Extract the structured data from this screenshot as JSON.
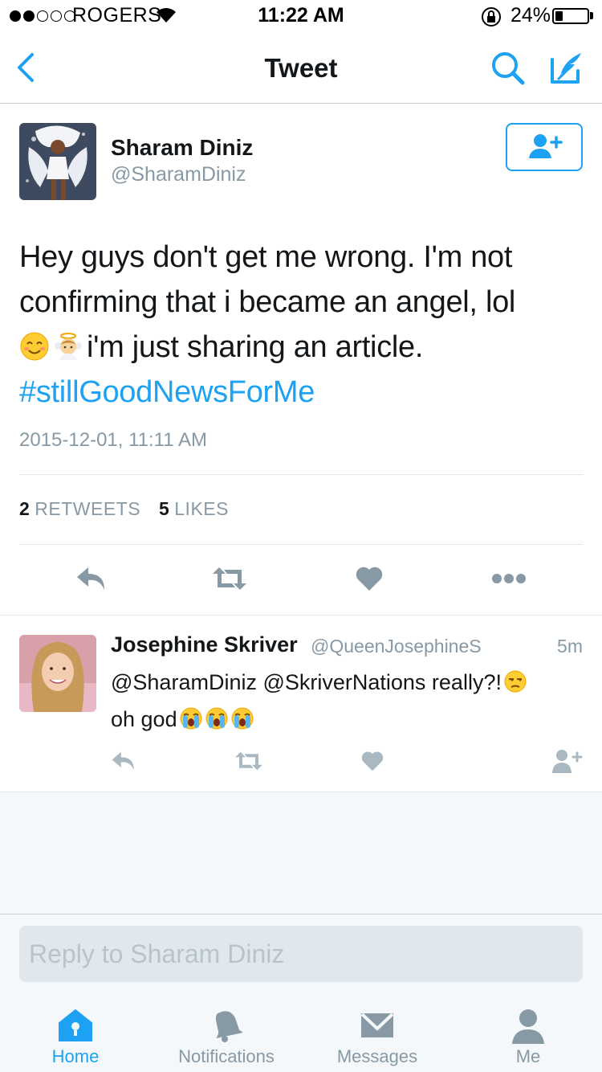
{
  "status_bar": {
    "carrier": "ROGERS",
    "time": "11:22 AM",
    "battery_percent": "24%",
    "battery_level": 0.24,
    "signal_bars_filled": 2,
    "signal_bars_total": 5
  },
  "nav": {
    "title": "Tweet",
    "back_icon": "chevron-left-icon",
    "search_icon": "search-icon",
    "compose_icon": "compose-icon"
  },
  "tweet": {
    "author_name": "Sharam Diniz",
    "author_handle": "@SharamDiniz",
    "text_line1": "Hey guys don't get me wrong. I'm not",
    "text_line2": "confirming that i became an angel, lol",
    "text_line3": "i'm just sharing an article.",
    "hashtag": "#stillGoodNewsForMe",
    "timestamp": "2015-12-01, 11:11 AM",
    "retweets_count": "2",
    "retweets_label": "RETWEETS",
    "likes_count": "5",
    "likes_label": "LIKES"
  },
  "reply": {
    "author_name": "Josephine Skriver",
    "author_handle": "@QueenJosephineS",
    "time": "5m",
    "text_line1": "@SharamDiniz @SkriverNations really?!",
    "text_line2": "oh god"
  },
  "composer": {
    "placeholder": "Reply to Sharam Diniz"
  },
  "tabs": [
    {
      "label": "Home",
      "icon": "home-icon",
      "active": true
    },
    {
      "label": "Notifications",
      "icon": "bell-icon",
      "active": false
    },
    {
      "label": "Messages",
      "icon": "envelope-icon",
      "active": false
    },
    {
      "label": "Me",
      "icon": "person-icon",
      "active": false
    }
  ],
  "colors": {
    "accent": "#1da1f2",
    "secondary_text": "#8899a6",
    "action_icon": "#8899a6",
    "background_grey": "#f5f8fa"
  }
}
